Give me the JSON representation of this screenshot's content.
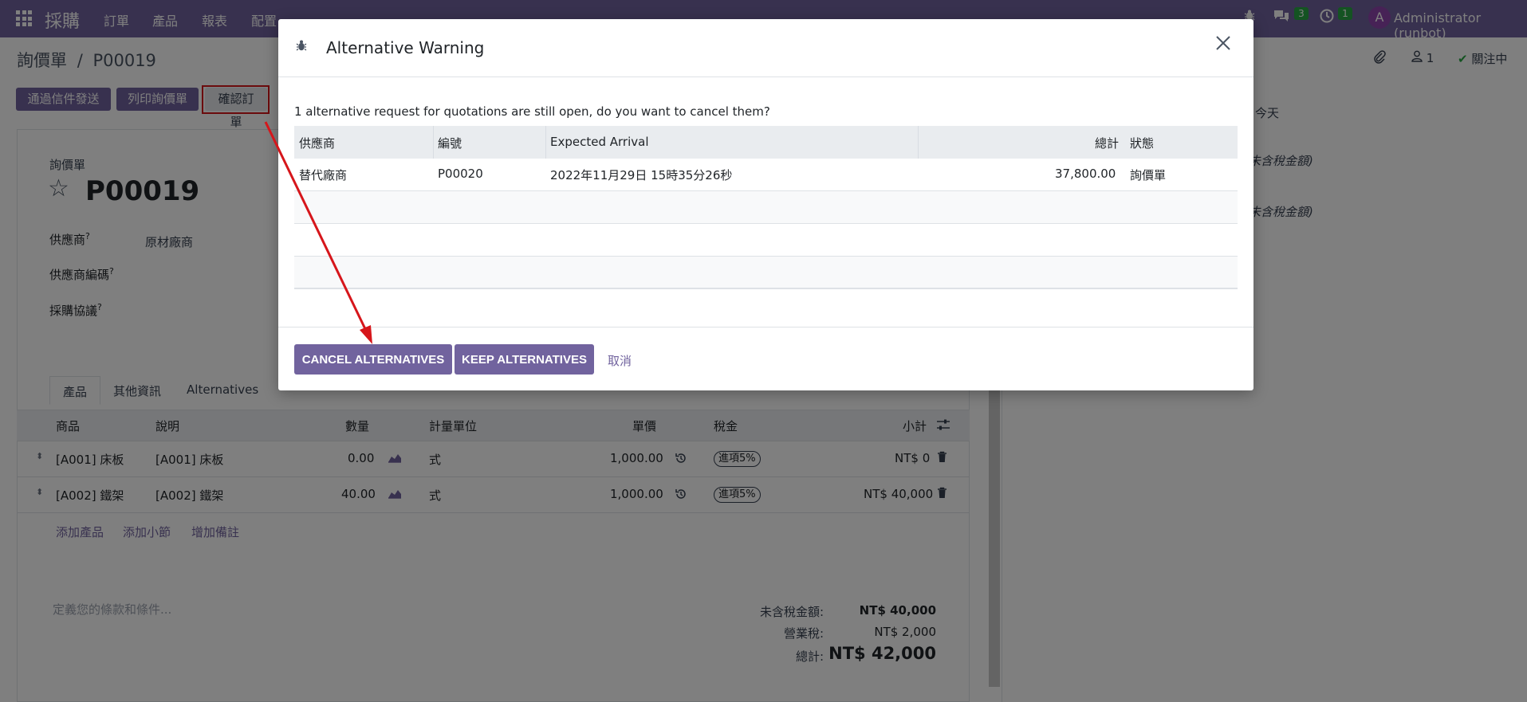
{
  "navbar": {
    "app_name": "採購",
    "menus": [
      "訂單",
      "產品",
      "報表",
      "配置"
    ],
    "messages_count": "3",
    "activities_count": "1",
    "user_initial": "A",
    "user_name": "Administrator (runbot)"
  },
  "control_panel": {
    "breadcrumb_parent": "詢價單",
    "breadcrumb_sep": "/",
    "breadcrumb_current": "P00019",
    "followers_count": "1",
    "follow_label": "關注中",
    "buttons": {
      "send_email": "通過信件發送",
      "print_rfq": "列印詢價單",
      "confirm_order": "確認訂單"
    }
  },
  "form": {
    "subtitle": "詢價單",
    "title": "P00019",
    "vendor_label": "供應商",
    "vendor_value": "原材廠商",
    "vendor_ref_label": "供應商編碼",
    "agreement_label": "採購協議",
    "tabs": [
      "產品",
      "其他資訊",
      "Alternatives"
    ],
    "lines_headers": {
      "product": "商品",
      "description": "說明",
      "quantity": "數量",
      "uom": "計量單位",
      "price": "單價",
      "taxes": "稅金",
      "subtotal": "小計"
    },
    "lines": [
      {
        "product": "[A001] 床板",
        "description": "[A001] 床板",
        "quantity": "0.00",
        "uom": "式",
        "price": "1,000.00",
        "tax": "進項5%",
        "subtotal": "NT$ 0"
      },
      {
        "product": "[A002] 鐵架",
        "description": "[A002] 鐵架",
        "quantity": "40.00",
        "uom": "式",
        "price": "1,000.00",
        "tax": "進項5%",
        "subtotal": "NT$ 40,000"
      }
    ],
    "add_product": "添加產品",
    "add_section": "添加小節",
    "add_note": "增加備註",
    "terms_placeholder": "定義您的條款和條件...",
    "totals": {
      "untaxed_label": "未含稅金額:",
      "untaxed_value": "NT$ 40,000",
      "tax_label": "營業稅:",
      "tax_value": "NT$ 2,000",
      "total_label": "總計:",
      "total_value": "NT$ 42,000"
    }
  },
  "chatter": {
    "today": "今天",
    "untaxed_note_1": "未含稅金額)",
    "untaxed_note_2": "未含稅金額)"
  },
  "modal": {
    "title": "Alternative Warning",
    "message": "1 alternative request for quotations are still open, do you want to cancel them?",
    "table_headers": {
      "vendor": "供應商",
      "reference": "編號",
      "expected_arrival": "Expected Arrival",
      "total": "總計",
      "status": "狀態"
    },
    "rows": [
      {
        "vendor": "替代廠商",
        "reference": "P00020",
        "expected_arrival": "2022年11月29日 15時35分26秒",
        "total": "37,800.00",
        "status": "詢價單"
      }
    ],
    "buttons": {
      "cancel_alternatives": "CANCEL ALTERNATIVES",
      "keep_alternatives": "KEEP ALTERNATIVES",
      "discard": "取消"
    }
  },
  "colors": {
    "brand": "#71639e",
    "annotation_red": "#d6161b",
    "badge_green": "#28a745"
  }
}
